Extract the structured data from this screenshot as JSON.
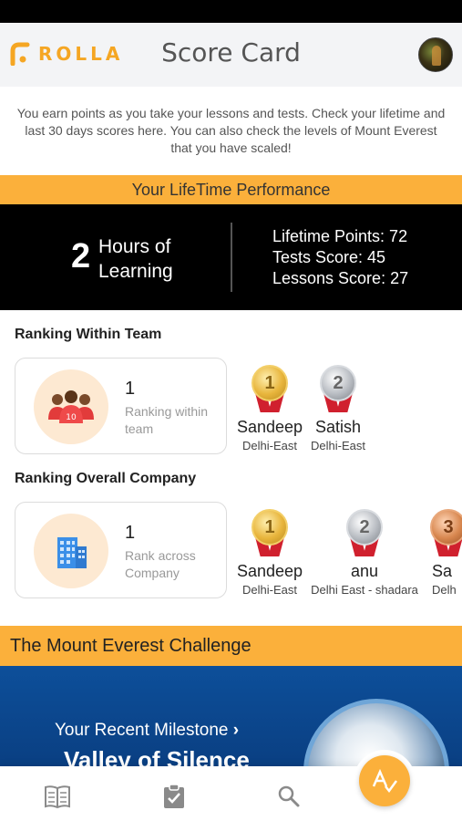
{
  "header": {
    "logo_text": "ROLLA",
    "title": "Score Card"
  },
  "intro": {
    "text": "You earn points as you take your lessons and tests. Check your lifetime and last 30 days scores here. You can also check the levels of Mount Everest that you have scaled!"
  },
  "lifetime": {
    "title": "Your LifeTime Performance",
    "hours_value": "2",
    "hours_label": "Hours of Learning",
    "lifetime_points": "Lifetime Points: 72",
    "tests_score": "Tests Score: 45",
    "lessons_score": "Lessons Score: 27"
  },
  "team_ranking": {
    "heading": "Ranking Within Team",
    "rank": "1",
    "rank_label": "Ranking within team",
    "leaders": [
      {
        "medal": "gold",
        "name": "Sandeep",
        "location": "Delhi-East"
      },
      {
        "medal": "silver",
        "name": "Satish",
        "location": "Delhi-East"
      }
    ]
  },
  "company_ranking": {
    "heading": "Ranking Overall Company",
    "rank": "1",
    "rank_label": "Rank across Company",
    "leaders": [
      {
        "medal": "gold",
        "name": "Sandeep",
        "location": "Delhi-East"
      },
      {
        "medal": "silver",
        "name": "anu",
        "location": "Delhi East - shadara"
      },
      {
        "medal": "bronze",
        "name": "Sa",
        "location": "Delh"
      }
    ]
  },
  "everest": {
    "title": "The Mount Everest Challenge",
    "milestone_label": "Your Recent Milestone",
    "milestone_place": "Valley of Silence"
  },
  "bottom_nav": {
    "items": [
      "lessons-book-icon",
      "tests-clipboard-icon",
      "search-icon",
      "scorecard-icon"
    ]
  },
  "colors": {
    "accent": "#fbb03b",
    "header_bg": "#f3f4f6",
    "everest_blue": "#0d4f9a"
  }
}
